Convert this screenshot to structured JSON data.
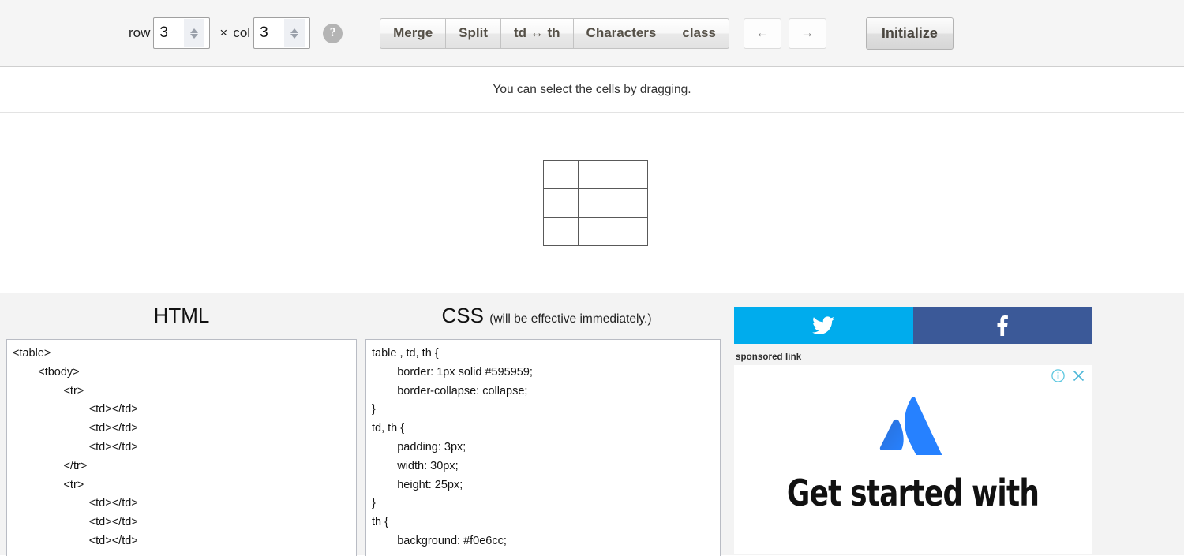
{
  "toolbar": {
    "row_label": "row",
    "row_value": "3",
    "times_symbol": "×",
    "col_label": "col",
    "col_value": "3",
    "help_icon": "help-icon",
    "help_glyph": "?",
    "buttons": [
      {
        "label": "Merge",
        "name": "merge-button"
      },
      {
        "label": "Split",
        "name": "split-button"
      },
      {
        "label": "td ↔ th",
        "name": "td-th-toggle-button"
      },
      {
        "label": "Characters",
        "name": "characters-button"
      },
      {
        "label": "class",
        "name": "class-button"
      }
    ],
    "arrow_prev": "←",
    "arrow_next": "→",
    "initialize_label": "Initialize"
  },
  "hint": {
    "text": "You can select the cells by dragging."
  },
  "preview": {
    "rows": 3,
    "cols": 3,
    "border_color": "#595959"
  },
  "editors": {
    "html": {
      "title": "HTML",
      "code": "<table>\n\t<tbody>\n\t\t<tr>\n\t\t\t<td></td>\n\t\t\t<td></td>\n\t\t\t<td></td>\n\t\t</tr>\n\t\t<tr>\n\t\t\t<td></td>\n\t\t\t<td></td>\n\t\t\t<td></td>"
    },
    "css": {
      "title": "CSS",
      "subtitle": "(will be effective immediately.)",
      "code": "table , td, th {\n\tborder: 1px solid #595959;\n\tborder-collapse: collapse;\n}\ntd, th {\n\tpadding: 3px;\n\twidth: 30px;\n\theight: 25px;\n}\nth {\n\tbackground: #f0e6cc;"
    }
  },
  "social": {
    "twitter_label": "twitter-share",
    "twitter_color": "#00aced",
    "facebook_label": "facebook-share",
    "facebook_color": "#3b5998"
  },
  "ad": {
    "sponsored_label": "sponsored link",
    "info_glyph": "ⓘ",
    "close_glyph": "✕",
    "brand": "Atlassian",
    "headline": "Get started with",
    "logo_color": "#2681ff",
    "logo_shadow_color": "#2b6fd6"
  }
}
